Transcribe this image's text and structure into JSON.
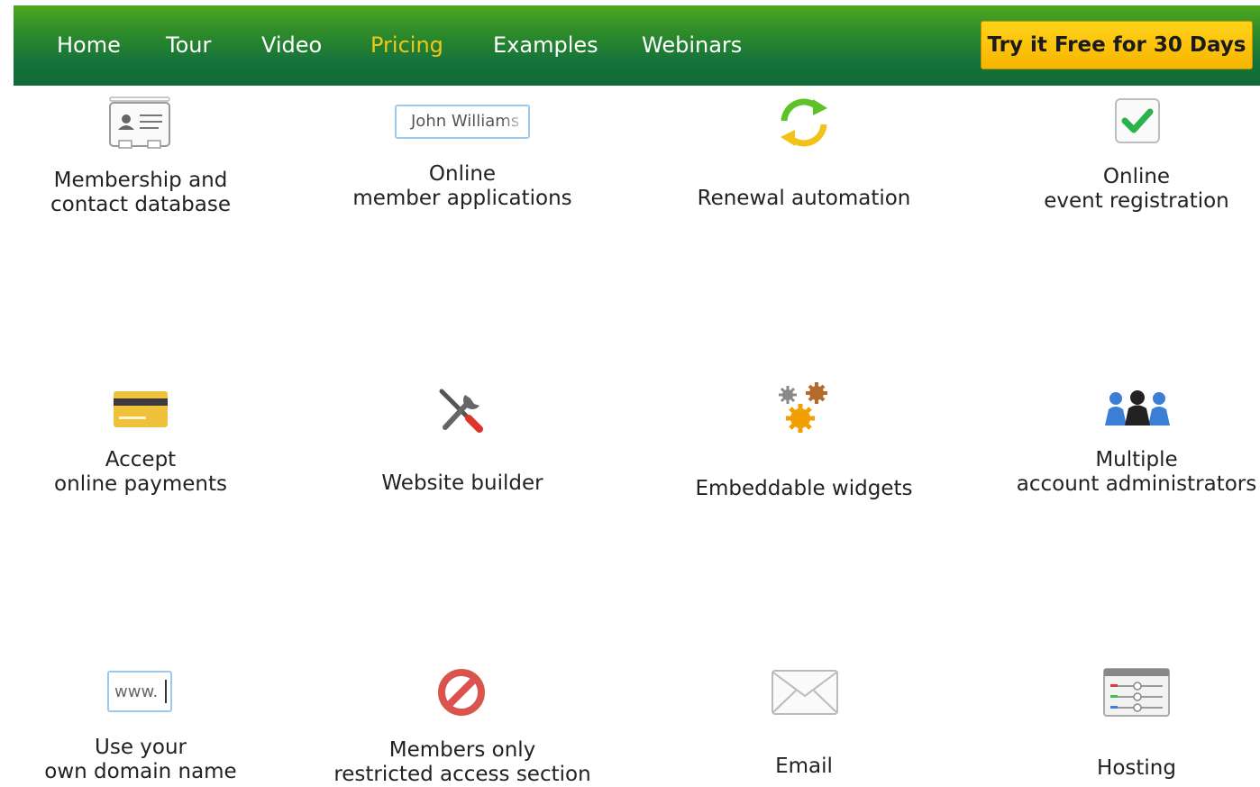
{
  "nav": {
    "items": [
      {
        "label": "Home",
        "active": false
      },
      {
        "label": "Tour",
        "active": false
      },
      {
        "label": "Video",
        "active": false
      },
      {
        "label": "Pricing",
        "active": true
      },
      {
        "label": "Examples",
        "active": false
      },
      {
        "label": "Webinars",
        "active": false
      }
    ],
    "cta_label": "Try it Free for 30 Days"
  },
  "features": [
    {
      "icon": "contact-card-icon",
      "lines": [
        "Membership and",
        "contact database"
      ]
    },
    {
      "icon": "name-input-icon",
      "icon_text": "John Williams",
      "lines": [
        "Online",
        "member applications"
      ]
    },
    {
      "icon": "renewal-arrows-icon",
      "lines": [
        "Renewal automation"
      ]
    },
    {
      "icon": "checkmark-icon",
      "lines": [
        "Online",
        "event registration"
      ]
    },
    {
      "icon": "credit-card-icon",
      "lines": [
        "Accept",
        "online payments"
      ]
    },
    {
      "icon": "tools-icon",
      "lines": [
        "Website builder"
      ]
    },
    {
      "icon": "gears-icon",
      "lines": [
        "Embeddable widgets"
      ]
    },
    {
      "icon": "people-icon",
      "lines": [
        "Multiple",
        "account administrators"
      ]
    },
    {
      "icon": "domain-input-icon",
      "icon_text": "www.",
      "lines": [
        "Use your",
        "own domain name"
      ]
    },
    {
      "icon": "no-entry-icon",
      "lines": [
        "Members only",
        "restricted access section"
      ]
    },
    {
      "icon": "envelope-icon",
      "lines": [
        "Email"
      ]
    },
    {
      "icon": "server-icon",
      "lines": [
        "Hosting"
      ]
    }
  ],
  "colors": {
    "nav_green_top": "#4fa81f",
    "nav_green_bottom": "#0f6a36",
    "active_nav": "#f2c617",
    "cta_yellow": "#ffc800",
    "check_green": "#2bb24c",
    "card_yellow": "#f0c13a",
    "no_entry_red": "#d9534f",
    "gear_orange": "#f0a000",
    "people_blue": "#3a7fd5"
  }
}
